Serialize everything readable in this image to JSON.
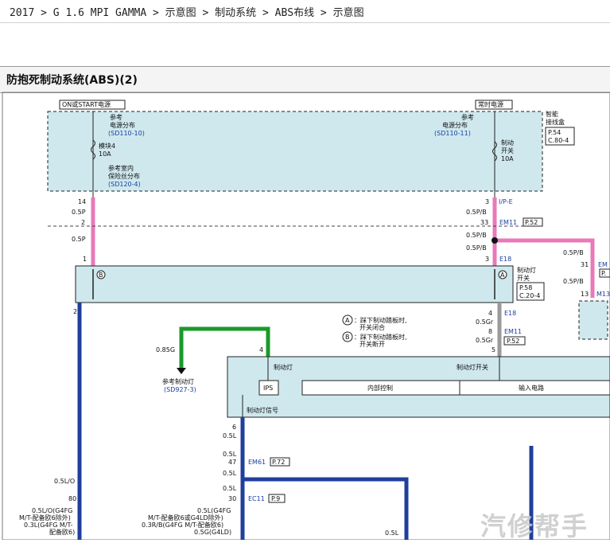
{
  "breadcrumb": "2017 > G 1.6 MPI GAMMA > 示意图 > 制动系统 > ABS布线 > 示意图",
  "title": "防抱死制动系统(ABS)(2)",
  "labels": {
    "on_start": "ON或START电源",
    "always": "常时电源",
    "smart_box_1": "智能",
    "smart_box_2": "接线盒",
    "ref1": "参考",
    "ref_power_dist": "电源分布",
    "sd110_10": "(SD110-10)",
    "sd110_11": "(SD110-11)",
    "module4": "模块4",
    "10a": "10A",
    "ref_indoor": "参考室内",
    "fuse_dist": "保险丝分布",
    "sd120_4": "(SD120-4)",
    "brake_switch_fuse_1": "制动",
    "brake_switch_fuse_2": "开关",
    "p54": "P.54",
    "c80_4": "C.80-4",
    "ip_e": "I/P-E",
    "em11": "EM11",
    "p52": "P.52",
    "e18": "E18",
    "brake_lamp_switch_1": "制动灯",
    "brake_lamp_switch_2": "开关",
    "p58": "P.58",
    "c20_4": "C.20-4",
    "em_trunc": "EM",
    "p_trunc": "P.",
    "m13_trunc": "M13",
    "legend_a_1": "：踩下制动踏板时,",
    "legend_a_2": "开关闭合",
    "legend_b_1": "：踩下制动踏板时,",
    "legend_b_2": "开关断开",
    "a": "A",
    "b": "B",
    "ref_brake_lamp": "参考制动灯",
    "sd927_3": "(SD927-3)",
    "brake_lamp": "制动灯",
    "brake_lamp_sw": "制动灯开关",
    "ips": "IPS",
    "internal_ctrl": "内部控制",
    "input_circuit": "输入电路",
    "brake_lamp_signal": "制动灯信号",
    "em61": "EM61",
    "p72": "P.72",
    "ec11": "EC11",
    "p9": "P.9",
    "n14": "14",
    "n2a": "2",
    "n1": "1",
    "n2b": "2",
    "n3a": "3",
    "n33": "33",
    "n3b": "3",
    "n4a": "4",
    "n8": "8",
    "n5": "5",
    "n31": "31",
    "n13": "13",
    "n4b": "4",
    "n6": "6",
    "n47": "47",
    "n30": "30",
    "n80": "80",
    "w05p_1": "0.5P",
    "w05p_2": "0.5P",
    "w05pb_1": "0.5P/B",
    "w05pb_2": "0.5P/B",
    "w05pb_3": "0.5P/B",
    "w05pb_4": "0.5P/B",
    "w05pb_5": "0.5P/B",
    "w05gr_1": "0.5Gr",
    "w05gr_2": "0.5Gr",
    "w085g": "0.85G",
    "w05l_1": "0.5L",
    "w05l_2": "0.5L",
    "w05l_3": "0.5L",
    "w05l_4": "0.5L",
    "w05l_5": "0.5L",
    "w05lo": "0.5L/O",
    "left_wire_1": "0.5L/O(G4FG",
    "left_wire_2": "M/T-配备欧6除外)",
    "left_wire_3": "0.3L(G4FG M/T-",
    "left_wire_4": "配备欧6)",
    "mid_wire_1": "0.5L(G4FG",
    "mid_wire_2": "M/T-配备欧6或G4LD除外)",
    "mid_wire_3": "0.3R/B(G4FG M/T-配备欧6)",
    "mid_wire_4": "0.5G(G4LD)"
  },
  "watermark": "汽修帮手",
  "colors": {
    "pink": "#e87ab8",
    "blue": "#1f3f9e",
    "green": "#1a9a2a",
    "gray": "#9a9a9a",
    "panel": "#cfe8ee"
  }
}
